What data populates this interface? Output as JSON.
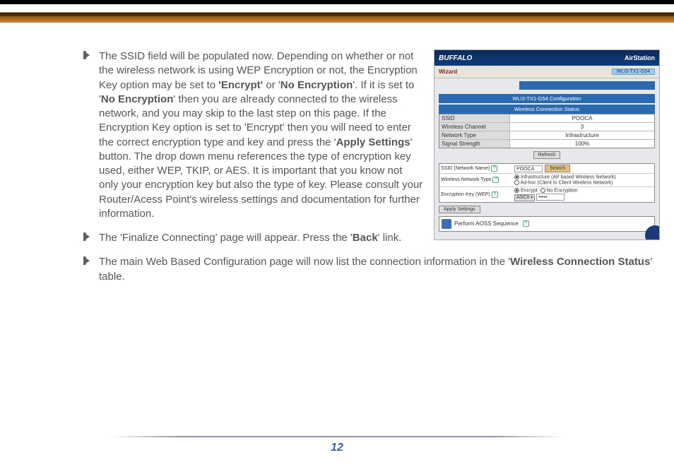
{
  "topbar": {},
  "bullets": [
    {
      "html": "The SSID field will be populated now.  Depending on whether or not the wireless network is using WEP Encryption or not, the Encryption Key option may be set  to <b>'Encrypt'</b> or '<b>No Encryption</b>'.  If it is set to '<b>No Encryption</b>' then you are already connected to the wireless network, and you may skip to the last step on this page.  If the Encryption Key option is set to 'Encrypt' then you will need to enter the correct encryption type and key and press the '<b>Apply Settings</b>' button.  The drop down menu references the type of encryption key used, either WEP, TKIP, or AES.  It is important that you know not only your encryption key but also the type of key.  Please consult your Router/Acess Point's wireless settings and documentation for further information."
    },
    {
      "html": "The 'Finalize Connecting' page will appear. Press the '<b>Back</b>' link."
    },
    {
      "html": "The main Web Based Configuration page will now list the connection information in the '<b>Wireless Connection Status</b>' table."
    }
  ],
  "screenshot": {
    "brand": "BUFFALO",
    "airstation": "AirStation",
    "wizard": "Wizard",
    "model_pill": "WLI3-TX1-G54",
    "title": "WLI3-TX1-G54 Configuration",
    "status_header": "Wireless Connection Status",
    "status_rows": [
      {
        "l": "SSID",
        "r": "POOCA"
      },
      {
        "l": "Wireless Channel",
        "r": "3"
      },
      {
        "l": "Network Type",
        "r": "Infrastructure"
      },
      {
        "l": "Signal Strength",
        "r": "100%"
      }
    ],
    "refresh": "Refresh",
    "panel": {
      "rows": [
        {
          "label": "SSID (Network Name)",
          "type": "search",
          "value": "POOCA",
          "button": "Search"
        },
        {
          "label": "Wireless Network Type",
          "type": "radio2",
          "opt1": "Infrastructure (AP based Wireless Network)",
          "opt2": "Ad-hoc (Client to Client Wireless Network)"
        },
        {
          "label": "Encryption Key (WEP)",
          "type": "radio-enc",
          "opt1": "Encrypt",
          "opt2": "No Encryption",
          "select": "ASCII",
          "dots": "•••••"
        }
      ]
    },
    "apply": "Apply Settings",
    "bottom": "Perform AOSS Sequence"
  },
  "page_number": "12",
  "topbar_height": 32
}
